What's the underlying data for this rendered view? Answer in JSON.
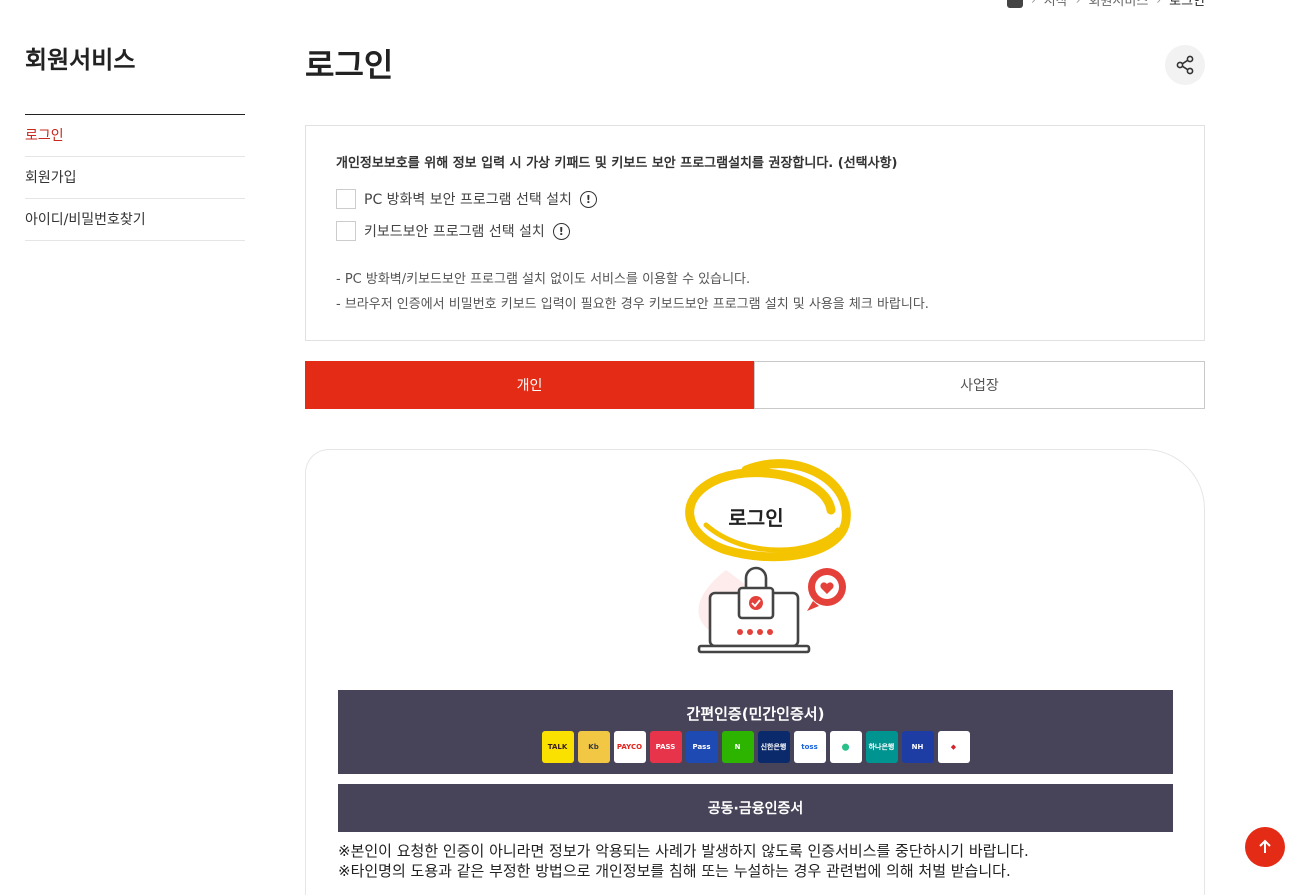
{
  "breadcrumb": {
    "items": [
      "시작",
      "회원서비스"
    ],
    "current": "로그인"
  },
  "sidebar": {
    "title": "회원서비스",
    "items": [
      {
        "label": "로그인",
        "active": true
      },
      {
        "label": "회원가입",
        "active": false
      },
      {
        "label": "아이디/비밀번호찾기",
        "active": false
      }
    ]
  },
  "main": {
    "title": "로그인",
    "notice": {
      "text": "개인정보보호를 위해 정보 입력 시 가상 키패드 및 키보드 보안 프로그램설치를 권장합니다. (선택사항)",
      "options": [
        {
          "label": "PC 방화벽 보안 프로그램 선택 설치"
        },
        {
          "label": "키보드보안 프로그램 선택 설치"
        }
      ],
      "notes": [
        "- PC 방화벽/키보드보안 프로그램 설치 없이도 서비스를 이용할 수 있습니다.",
        "- 브라우저 인증에서 비밀번호 키보드 입력이 필요한 경우 키보드보안 프로그램 설치 및 사용을 체크 바랍니다."
      ]
    },
    "tabs": [
      {
        "label": "개인",
        "active": true
      },
      {
        "label": "사업장",
        "active": false
      }
    ],
    "card": {
      "heading": "로그인",
      "simple_auth_label": "간편인증(민간인증서)",
      "providers": [
        {
          "name": "kakao-talk",
          "text": "TALK",
          "bg": "#fae100",
          "fg": "#3c1e1e"
        },
        {
          "name": "kb",
          "text": "Kb",
          "bg": "#f2c744",
          "fg": "#3b3b3b"
        },
        {
          "name": "payco",
          "text": "PAYCO",
          "bg": "#ffffff",
          "fg": "#e3231c"
        },
        {
          "name": "pass",
          "text": "PASS",
          "bg": "#e8344a",
          "fg": "#ffffff"
        },
        {
          "name": "samsung-pass",
          "text": "Pass",
          "bg": "#1e4ab4",
          "fg": "#ffffff"
        },
        {
          "name": "naver",
          "text": "N",
          "bg": "#2db400",
          "fg": "#ffffff"
        },
        {
          "name": "shinhan",
          "text": "신한은행",
          "bg": "#0b2a6b",
          "fg": "#ffffff"
        },
        {
          "name": "toss",
          "text": "toss",
          "bg": "#ffffff",
          "fg": "#1b64da"
        },
        {
          "name": "banksalad",
          "text": "⬤",
          "bg": "#ffffff",
          "fg": "#2bbf8a"
        },
        {
          "name": "hana",
          "text": "하나은행",
          "bg": "#009490",
          "fg": "#ffffff"
        },
        {
          "name": "nh",
          "text": "NH",
          "bg": "#1d3da5",
          "fg": "#ffffff"
        },
        {
          "name": "korea-info",
          "text": "◆",
          "bg": "#ffffff",
          "fg": "#d5232b"
        }
      ],
      "cert_label": "공동·금융인증서",
      "warnings": [
        "※본인이 요청한 인증이 아니라면 정보가 악용되는 사례가 발생하지 않도록 인증서비스를 중단하시기 바랍니다.",
        "※타인명의 도용과 같은 부정한 방법으로 개인정보를 침해 또는 누설하는 경우 관련법에 의해 처벌 받습니다."
      ]
    }
  },
  "colors": {
    "accent": "#e32b16",
    "dark_button": "#474459",
    "highlight": "#f5c400"
  }
}
